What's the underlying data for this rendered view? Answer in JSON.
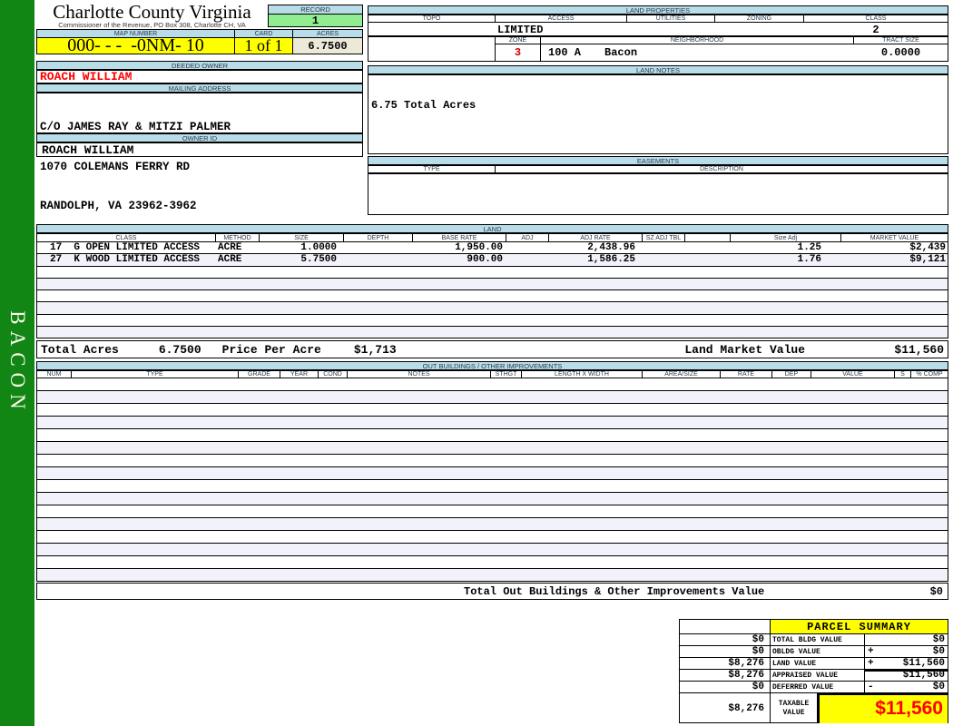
{
  "county": {
    "title": "Charlotte County Virginia",
    "subtitle": "Commissioner of the Revenue, PO Box 308, Charlotte CH, VA"
  },
  "sidebar": {
    "label": "BACON"
  },
  "record": {
    "label": "RECORD",
    "value": "1"
  },
  "map": {
    "map_number_label": "MAP NUMBER",
    "map_number": "000- - -  -0NM- 10",
    "card_label": "CARD",
    "card": "1 of 1",
    "acres_label": "ACRES",
    "acres": "6.7500"
  },
  "owner": {
    "deeded_label": "DEEDED OWNER",
    "deeded_owner": "ROACH WILLIAM",
    "mailing_label": "MAILING ADDRESS",
    "address_line1": "C/O JAMES RAY & MITZI PALMER",
    "address_line2": "1070 COLEMANS FERRY RD",
    "address_line3": "RANDOLPH, VA 23962-3962",
    "owner_id_label": "OWNER ID",
    "owner_id": "ROACH WILLIAM"
  },
  "land_properties": {
    "title": "LAND PROPERTIES",
    "headers": [
      "TOPO",
      "ACCESS",
      "UTILITIES",
      "ZONING",
      "CLASS"
    ],
    "access_value": "LIMITED",
    "class_value": "2",
    "zone_label": "ZONE",
    "zone": "3",
    "neighborhood_label": "NEIGHBORHOOD",
    "neighborhood_code": "100 A",
    "neighborhood_name": "Bacon",
    "tract_size_label": "TRACT SIZE",
    "tract_size": "0.0000"
  },
  "land_notes": {
    "title": "LAND NOTES",
    "note": "6.75 Total Acres"
  },
  "easements": {
    "title": "EASEMENTS",
    "type_label": "TYPE",
    "description_label": "DESCRIPTION"
  },
  "land": {
    "title": "LAND",
    "headers": [
      "CLASS",
      "METHOD",
      "SIZE",
      "DEPTH",
      "BASE RATE",
      "ADJ",
      "ADJ RATE",
      "SZ ADJ TBL",
      "",
      "Size Adj",
      "MARKET VALUE"
    ],
    "rows": [
      {
        "class": "17  G OPEN LIMITED ACCESS",
        "method": "ACRE",
        "size": "1.0000",
        "depth": "",
        "base_rate": "1,950.00",
        "adj": "",
        "adj_rate": "2,438.96",
        "sz_adj_tbl": "",
        "size_adj": "1.25",
        "market_value": "$2,439"
      },
      {
        "class": "27  K WOOD LIMITED ACCESS",
        "method": "ACRE",
        "size": "5.7500",
        "depth": "",
        "base_rate": "900.00",
        "adj": "",
        "adj_rate": "1,586.25",
        "sz_adj_tbl": "",
        "size_adj": "1.76",
        "market_value": "$9,121"
      }
    ],
    "empty_rows": 6,
    "totals": {
      "total_acres_label": "Total Acres",
      "total_acres": "6.7500",
      "price_per_acre_label": "Price Per Acre",
      "price_per_acre": "$1,713",
      "market_label": "Land Market Value",
      "market_value": "$11,560"
    }
  },
  "out_buildings": {
    "title": "OUT BUILDINGS / OTHER IMPROVEMENTS",
    "headers": [
      "NUM",
      "TYPE",
      "GRADE",
      "YEAR",
      "COND",
      "NOTES",
      "STHGT",
      "LENGTH X WIDTH",
      "AREA/SIZE",
      "RATE",
      "DEP",
      "VALUE",
      "S",
      "% COMP"
    ],
    "empty_rows": 16,
    "total_label": "Total Out Buildings & Other Improvements Value",
    "total_value": "$0"
  },
  "parcel_summary": {
    "title": "PARCEL SUMMARY",
    "rows": [
      {
        "prior": "$0",
        "label": "TOTAL BLDG VALUE",
        "op": "",
        "value": "$0"
      },
      {
        "prior": "$0",
        "label": "OBLDG VALUE",
        "op": "+",
        "value": "$0"
      },
      {
        "prior": "$8,276",
        "label": "LAND VALUE",
        "op": "+",
        "value": "$11,560"
      },
      {
        "prior": "$8,276",
        "label": "APPRAISED VALUE",
        "op": "",
        "value": "$11,560"
      },
      {
        "prior": "$0",
        "label": "DEFERRED VALUE",
        "op": "-",
        "value": "$0"
      }
    ],
    "taxable": {
      "prior": "$8,276",
      "label": "TAXABLE VALUE",
      "value": "$11,560"
    }
  }
}
